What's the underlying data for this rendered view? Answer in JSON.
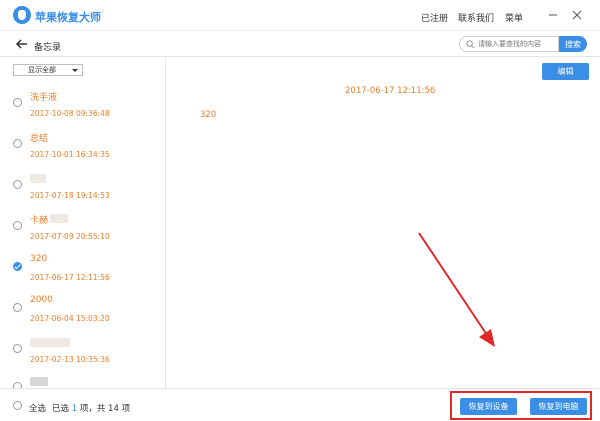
{
  "app": {
    "title": "苹果恢复大师",
    "accent_color": "#3a8ee6",
    "date_color": "#ee7e2a"
  },
  "topnav": {
    "registered": "已注册",
    "contact": "联系我们",
    "menu": "菜单"
  },
  "window_controls": {
    "minimize_icon": "minimize-icon",
    "close_icon": "close-icon"
  },
  "subbar": {
    "title": "备忘录",
    "search_placeholder": "请输入要查找的内容",
    "search_button": "搜索"
  },
  "sidebar": {
    "filter_label": "显示全部",
    "items": [
      {
        "title": "洗手液",
        "date": "2017-10-08 09:36:48",
        "checked": false,
        "blurred": false
      },
      {
        "title": "总结",
        "date": "2017-10-01 16:34:35",
        "checked": false,
        "blurred": false
      },
      {
        "title": "",
        "date": "2017-07-18 19:14:53",
        "checked": false,
        "blurred": true
      },
      {
        "title": "卡赫",
        "date": "2017-07-09 20:55:10",
        "checked": false,
        "blurred": true
      },
      {
        "title": "320",
        "date": "2017-06-17 12:11:56",
        "checked": true,
        "blurred": false
      },
      {
        "title": "2000",
        "date": "2017-06-04 15:03:20",
        "checked": false,
        "blurred": false
      },
      {
        "title": "",
        "date": "2017-02-13 10:35:36",
        "checked": false,
        "blurred": true
      },
      {
        "title": "",
        "date": "",
        "checked": false,
        "blurred": true
      }
    ]
  },
  "detail": {
    "edit_button": "编辑",
    "date": "2017-06-17 12:11:56",
    "body": "320"
  },
  "footer": {
    "select_all": "全选",
    "selected_prefix": "已选",
    "selected_count": "1",
    "selected_suffix": "项，共 14 项",
    "restore_device": "恢复到设备",
    "restore_pc": "恢复到电脑"
  }
}
